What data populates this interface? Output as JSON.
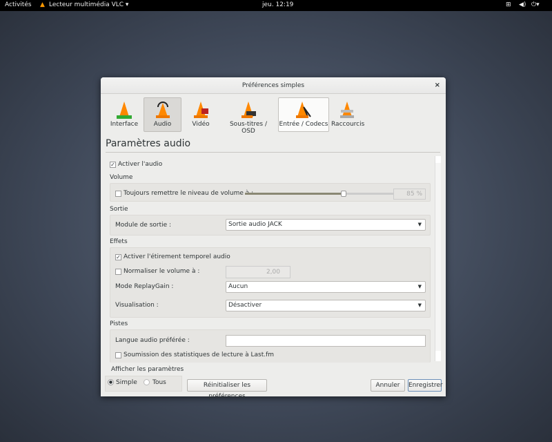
{
  "topbar": {
    "activities": "Activités",
    "app": "Lecteur multimédia VLC ▾",
    "clock": "jeu. 12:19"
  },
  "dialog": {
    "title": "Préférences simples",
    "close": "×",
    "tabs": [
      {
        "label": "Interface"
      },
      {
        "label": "Audio"
      },
      {
        "label": "Vidéo"
      },
      {
        "label": "Sous-titres / OSD"
      },
      {
        "label": "Entrée / Codecs"
      },
      {
        "label": "Raccourcis"
      }
    ],
    "heading": "Paramètres audio",
    "enable_audio": {
      "label": "Activer l'audio",
      "checked": true
    },
    "volume": {
      "title": "Volume",
      "always_reset": {
        "label": "Toujours remettre le niveau de volume à :",
        "checked": false
      },
      "value": "85 %",
      "percent": 85
    },
    "output": {
      "title": "Sortie",
      "module_label": "Module de sortie :",
      "module_value": "Sortie audio JACK"
    },
    "effects": {
      "title": "Effets",
      "time_stretch": {
        "label": "Activer l'étirement temporel audio",
        "checked": true
      },
      "normalize": {
        "label": "Normaliser le volume à :",
        "checked": false,
        "value": "2,00"
      },
      "replaygain_label": "Mode ReplayGain :",
      "replaygain_value": "Aucun",
      "visual_label": "Visualisation :",
      "visual_value": "Désactiver"
    },
    "tracks": {
      "title": "Pistes",
      "lang_label": "Langue audio préférée :",
      "lang_value": "",
      "lastfm": {
        "label": "Soumission des statistiques de lecture à Last.fm",
        "checked": false
      }
    },
    "show": {
      "title": "Afficher les paramètres",
      "simple": "Simple",
      "all": "Tous",
      "selected": "Simple"
    },
    "buttons": {
      "reset": "Réinitialiser les préférences",
      "cancel": "Annuler",
      "save": "Enregistrer"
    }
  }
}
